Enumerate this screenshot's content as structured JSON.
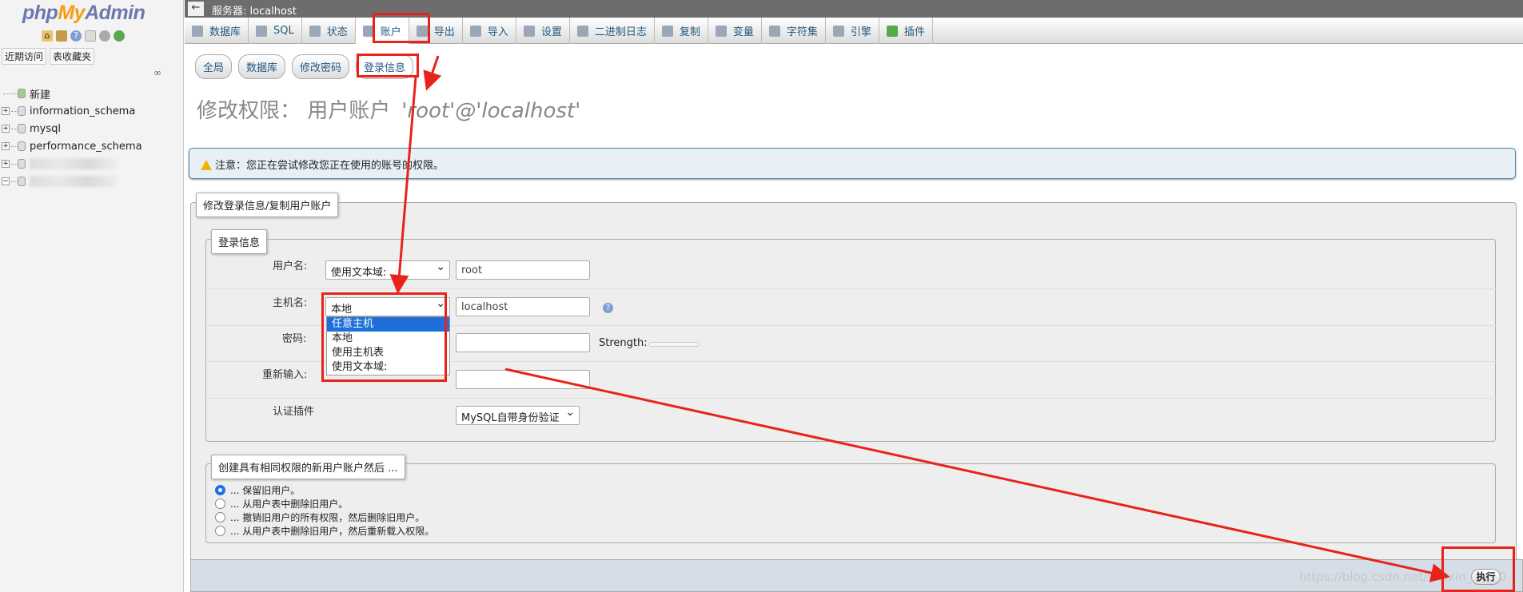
{
  "nav": {
    "logo": {
      "php": "php",
      "my": "My",
      "admin": "Admin"
    },
    "tabs": [
      "近期访问",
      "表收藏夹"
    ],
    "tree": [
      {
        "label": "新建",
        "type": "new"
      },
      {
        "label": "information_schema",
        "type": "db"
      },
      {
        "label": "mysql",
        "type": "db"
      },
      {
        "label": "performance_schema",
        "type": "db"
      },
      {
        "label": "",
        "type": "blurred"
      },
      {
        "label": "",
        "type": "blurred"
      }
    ]
  },
  "server_bar": {
    "title": "服务器: localhost"
  },
  "menu": {
    "items": [
      "数据库",
      "SQL",
      "状态",
      "账户",
      "导出",
      "导入",
      "设置",
      "二进制日志",
      "复制",
      "变量",
      "字符集",
      "引擎",
      "插件"
    ],
    "active": "账户"
  },
  "subtabs": {
    "items": [
      "全局",
      "数据库",
      "修改密码",
      "登录信息"
    ],
    "active": "登录信息"
  },
  "heading": {
    "prefix": "修改权限：  用户账户",
    "user": "'root'@'localhost'"
  },
  "notice": {
    "text": "注意：您正在尝试修改您正在使用的账号的权限。"
  },
  "form": {
    "outer_legend": "修改登录信息/复制用户账户",
    "inner_legend": "登录信息",
    "username": {
      "label": "用户名:",
      "select": "使用文本域:",
      "value": "root"
    },
    "hostname": {
      "label": "主机名:",
      "select": "本地",
      "value": "localhost",
      "options": [
        "任意主机",
        "本地",
        "使用主机表",
        "使用文本域:"
      ],
      "highlighted": "任意主机"
    },
    "password": {
      "label": "密码:",
      "strength_label": "Strength:"
    },
    "retype": {
      "label": "重新输入:"
    },
    "auth": {
      "label": "认证插件",
      "select": "MySQL自带身份验证"
    }
  },
  "create_section": {
    "legend": "创建具有相同权限的新用户账户然后 ...",
    "options": [
      "... 保留旧用户。",
      "... 从用户表中删除旧用户。",
      "... 撤销旧用户的所有权限，然后删除旧用户。",
      "... 从用户表中删除旧用户，然后重新载入权限。"
    ],
    "selected": 0
  },
  "submit": {
    "label": "执行"
  },
  "watermark": "https://blog.csdn.net/weixin_39...0",
  "colors": {
    "annotation": "#e8231b",
    "notice_border": "#4f8ab6",
    "highlight": "#1e6fd9"
  }
}
